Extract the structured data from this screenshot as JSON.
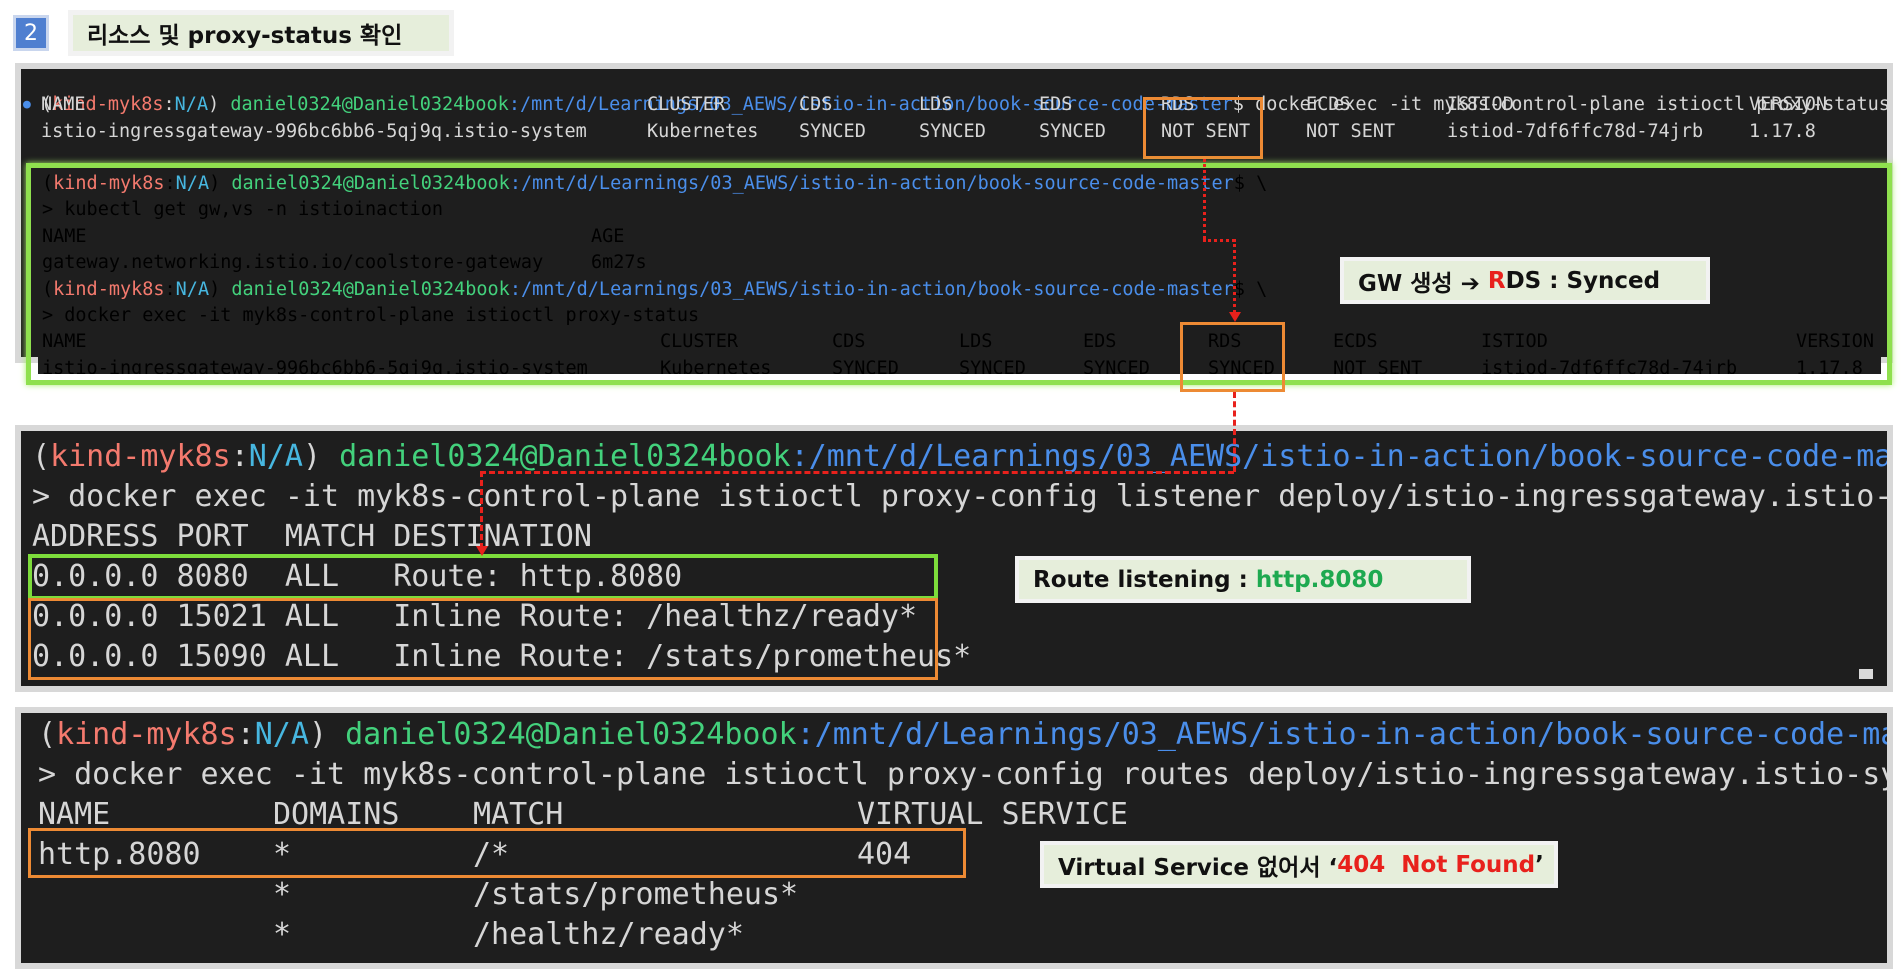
{
  "header": {
    "step_number": "2",
    "title": "리소스 및 proxy-status 확인"
  },
  "prompt": {
    "open_paren": "(",
    "context": "kind-myk8s",
    "colon": ":",
    "namespace": "N/A",
    "close_paren": ")",
    "user_host": "daniel0324@Daniel0324book",
    "path": ":/mnt/d/Learnings/03_AEWS/istio-in-action/book-source-code-master",
    "dollar": "$ ",
    "continuation": "\\"
  },
  "term1": {
    "dot": "●",
    "command": "docker exec -it myk8s-control-plane istioctl proxy-status",
    "headers": [
      "NAME",
      "CLUSTER",
      "CDS",
      "LDS",
      "EDS",
      "RDS",
      "ECDS",
      "ISTIOD",
      "VERSION"
    ],
    "row": [
      "istio-ingressgateway-996bc6bb6-5qj9q.istio-system",
      "Kubernetes",
      "SYNCED",
      "SYNCED",
      "SYNCED",
      "NOT SENT",
      "NOT SENT",
      "istiod-7df6ffc78d-74jrb",
      "1.17.8"
    ]
  },
  "term1g": {
    "cmd_get": "> kubectl get gw,vs -n istioinaction",
    "get_headers": [
      "NAME",
      "AGE"
    ],
    "get_row": [
      "gateway.networking.istio.io/coolstore-gateway",
      "6m27s"
    ],
    "cmd_status": "> docker exec -it myk8s-control-plane istioctl proxy-status",
    "headers": [
      "NAME",
      "CLUSTER",
      "CDS",
      "LDS",
      "EDS",
      "RDS",
      "ECDS",
      "ISTIOD",
      "VERSION"
    ],
    "row": [
      "istio-ingressgateway-996bc6bb6-5qj9q.istio-system",
      "Kubernetes",
      "SYNCED",
      "SYNCED",
      "SYNCED",
      "SYNCED",
      "NOT SENT",
      "istiod-7df6ffc78d-74jrb",
      "1.17.8"
    ]
  },
  "term2": {
    "command": "> docker exec -it myk8s-control-plane istioctl proxy-config listener deploy/istio-ingressgateway.istio-system",
    "header": "ADDRESS PORT  MATCH DESTINATION",
    "rows": [
      "0.0.0.0 8080  ALL   Route: http.8080",
      "0.0.0.0 15021 ALL   Inline Route: /healthz/ready*",
      "0.0.0.0 15090 ALL   Inline Route: /stats/prometheus*"
    ]
  },
  "term3": {
    "command": "> docker exec -it myk8s-control-plane istioctl proxy-config routes deploy/istio-ingressgateway.istio-system",
    "headers": [
      "NAME",
      "DOMAINS",
      "MATCH",
      "VIRTUAL SERVICE"
    ],
    "rows": [
      [
        "http.8080",
        "*",
        "/*",
        "404"
      ],
      [
        "",
        "*",
        "/stats/prometheus*",
        ""
      ],
      [
        "",
        "*",
        "/healthz/ready*",
        ""
      ]
    ]
  },
  "notes": {
    "gw_prefix": "GW 생성 ➔ ",
    "gw_r": "R",
    "gw_suffix": "DS : Synced",
    "route_prefix": "Route listening : ",
    "route_value": "http.8080",
    "vs_prefix": "Virtual Service 없어서 ‘",
    "vs_value": "404  Not Found",
    "vs_suffix": "’"
  },
  "colors": {
    "accent_orange": "#ed8a34",
    "accent_green": "#7ddc3b",
    "arrow_red": "#e8211c",
    "note_bg": "#e6eedb",
    "terminal_bg": "#1e1e1e"
  }
}
